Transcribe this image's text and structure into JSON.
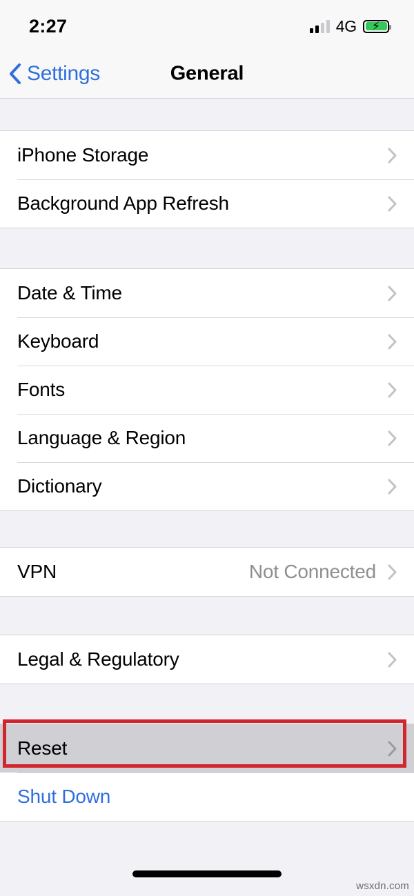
{
  "status_bar": {
    "time": "2:27",
    "network_label": "4G",
    "signal_bars_filled": 2,
    "signal_bars_total": 4,
    "battery_charging": true,
    "battery_color": "#34c759",
    "bolt_glyph": "⚡"
  },
  "nav": {
    "back_label": "Settings",
    "title": "General",
    "back_icon": "chevron-left-icon",
    "accent_color": "#2f6fdc"
  },
  "sections": [
    {
      "rows": [
        {
          "label": "iPhone Storage",
          "value": "",
          "accessory": "chevron-right-icon"
        },
        {
          "label": "Background App Refresh",
          "value": "",
          "accessory": "chevron-right-icon"
        }
      ]
    },
    {
      "rows": [
        {
          "label": "Date & Time",
          "value": "",
          "accessory": "chevron-right-icon"
        },
        {
          "label": "Keyboard",
          "value": "",
          "accessory": "chevron-right-icon"
        },
        {
          "label": "Fonts",
          "value": "",
          "accessory": "chevron-right-icon"
        },
        {
          "label": "Language & Region",
          "value": "",
          "accessory": "chevron-right-icon"
        },
        {
          "label": "Dictionary",
          "value": "",
          "accessory": "chevron-right-icon"
        }
      ]
    },
    {
      "rows": [
        {
          "label": "VPN",
          "value": "Not Connected",
          "accessory": "chevron-right-icon"
        }
      ]
    },
    {
      "rows": [
        {
          "label": "Legal & Regulatory",
          "value": "",
          "accessory": "chevron-right-icon"
        }
      ]
    },
    {
      "rows": [
        {
          "label": "Reset",
          "value": "",
          "accessory": "chevron-right-icon",
          "highlighted": true
        },
        {
          "label": "Shut Down",
          "value": "",
          "accessory": "",
          "link": true
        }
      ]
    }
  ],
  "annotation": {
    "target_row": "Reset",
    "box_color": "#d1262c"
  },
  "watermark": "wsxdn.com"
}
